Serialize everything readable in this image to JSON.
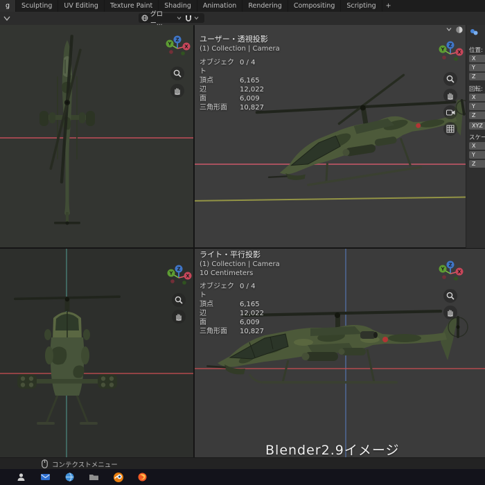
{
  "menubar": {
    "tabs": [
      "g",
      "Sculpting",
      "UV Editing",
      "Texture Paint",
      "Shading",
      "Animation",
      "Rendering",
      "Compositing",
      "Scripting"
    ],
    "add_button": "+"
  },
  "toolbar": {
    "orientation": "グロー...",
    "icons": {
      "orientation": "globe-icon",
      "snap": "magnet-icon",
      "expand": "chevron-icon"
    }
  },
  "viewport_top_right": {
    "title": "ユーザー・透視投影",
    "breadcrumb": "(1) Collection | Camera",
    "stats": [
      {
        "label": "オブジェクト",
        "value": "0 / 4"
      },
      {
        "label": "頂点",
        "value": "6,165"
      },
      {
        "label": "辺",
        "value": "12,022"
      },
      {
        "label": "面",
        "value": "6,009"
      },
      {
        "label": "三角形面",
        "value": "10,827"
      }
    ]
  },
  "viewport_bottom_right": {
    "title": "ライト・平行投影",
    "breadcrumb": "(1) Collection | Camera",
    "scale_indicator": "10 Centimeters",
    "stats": [
      {
        "label": "オブジェクト",
        "value": "0 / 4"
      },
      {
        "label": "頂点",
        "value": "6,165"
      },
      {
        "label": "辺",
        "value": "12,022"
      },
      {
        "label": "面",
        "value": "6,009"
      },
      {
        "label": "三角形面",
        "value": "10,827"
      }
    ]
  },
  "sidebar": {
    "location_label": "位置:",
    "rotation_label": "回転:",
    "rotation_mode": "XYZ",
    "scale_label": "スケー",
    "axis_x": "X",
    "axis_y": "Y",
    "axis_z": "Z"
  },
  "gizmo": {
    "x": "X",
    "y": "Y",
    "z": "Z"
  },
  "watermark": "Blender2.9イメージ",
  "statusbar": {
    "context_menu": "コンテクストメニュー"
  },
  "colors": {
    "axis_x_red": "#c8465a",
    "axis_y_green": "#5d9c33",
    "axis_z_blue": "#3f76c8",
    "blender_orange": "#e87d0d",
    "camo_base": "#4b5738",
    "camo_dark": "#36422a"
  }
}
